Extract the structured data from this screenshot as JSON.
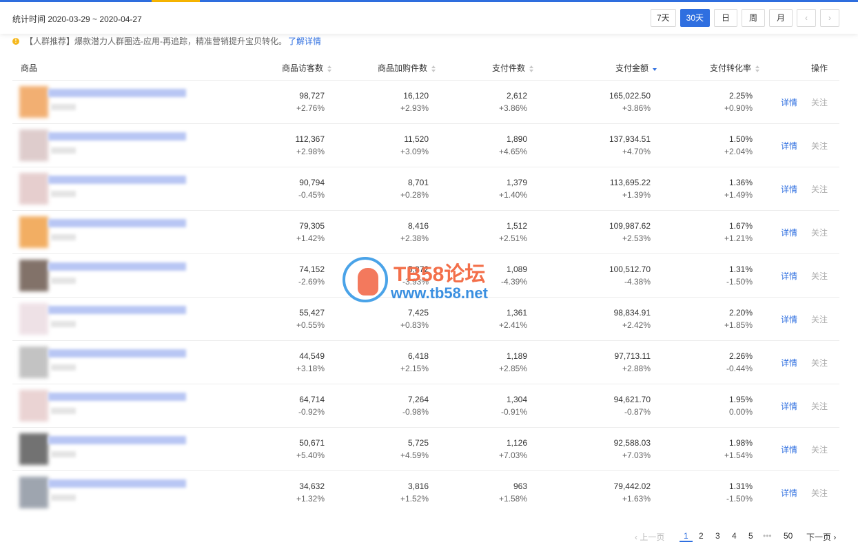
{
  "header": {
    "stat_time": "统计时间 2020-03-29 ~ 2020-04-27",
    "periods": [
      "7天",
      "30天",
      "日",
      "周",
      "月"
    ],
    "prev_arrow": "‹",
    "next_arrow": "›"
  },
  "notice": {
    "text": "【人群推荐】爆款潜力人群圈选-应用-再追踪，精准营销提升宝贝转化。",
    "link": "了解详情"
  },
  "columns": {
    "product": "商品",
    "visitors": "商品访客数",
    "cart": "商品加购件数",
    "pay_qty": "支付件数",
    "pay_amount": "支付金额",
    "conv": "支付转化率",
    "ops": "操作"
  },
  "rows": [
    {
      "visitors": "98,727",
      "visitors_chg": "+2.76%",
      "cart": "16,120",
      "cart_chg": "+2.93%",
      "pay_qty": "2,612",
      "pay_qty_chg": "+3.86%",
      "amount": "165,022.50",
      "amount_chg": "+3.86%",
      "conv": "2.25%",
      "conv_chg": "+0.90%",
      "detail": "详情",
      "follow": "关注"
    },
    {
      "visitors": "112,367",
      "visitors_chg": "+2.98%",
      "cart": "11,520",
      "cart_chg": "+3.09%",
      "pay_qty": "1,890",
      "pay_qty_chg": "+4.65%",
      "amount": "137,934.51",
      "amount_chg": "+4.70%",
      "conv": "1.50%",
      "conv_chg": "+2.04%",
      "detail": "详情",
      "follow": "关注"
    },
    {
      "visitors": "90,794",
      "visitors_chg": "-0.45%",
      "cart": "8,701",
      "cart_chg": "+0.28%",
      "pay_qty": "1,379",
      "pay_qty_chg": "+1.40%",
      "amount": "113,695.22",
      "amount_chg": "+1.39%",
      "conv": "1.36%",
      "conv_chg": "+1.49%",
      "detail": "详情",
      "follow": "关注"
    },
    {
      "visitors": "79,305",
      "visitors_chg": "+1.42%",
      "cart": "8,416",
      "cart_chg": "+2.38%",
      "pay_qty": "1,512",
      "pay_qty_chg": "+2.51%",
      "amount": "109,987.62",
      "amount_chg": "+2.53%",
      "conv": "1.67%",
      "conv_chg": "+1.21%",
      "detail": "详情",
      "follow": "关注"
    },
    {
      "visitors": "74,152",
      "visitors_chg": "-2.69%",
      "cart": "5,872",
      "cart_chg": "-3.93%",
      "pay_qty": "1,089",
      "pay_qty_chg": "-4.39%",
      "amount": "100,512.70",
      "amount_chg": "-4.38%",
      "conv": "1.31%",
      "conv_chg": "-1.50%",
      "detail": "详情",
      "follow": "关注"
    },
    {
      "visitors": "55,427",
      "visitors_chg": "+0.55%",
      "cart": "7,425",
      "cart_chg": "+0.83%",
      "pay_qty": "1,361",
      "pay_qty_chg": "+2.41%",
      "amount": "98,834.91",
      "amount_chg": "+2.42%",
      "conv": "2.20%",
      "conv_chg": "+1.85%",
      "detail": "详情",
      "follow": "关注"
    },
    {
      "visitors": "44,549",
      "visitors_chg": "+3.18%",
      "cart": "6,418",
      "cart_chg": "+2.15%",
      "pay_qty": "1,189",
      "pay_qty_chg": "+2.85%",
      "amount": "97,713.11",
      "amount_chg": "+2.88%",
      "conv": "2.26%",
      "conv_chg": "-0.44%",
      "detail": "详情",
      "follow": "关注"
    },
    {
      "visitors": "64,714",
      "visitors_chg": "-0.92%",
      "cart": "7,264",
      "cart_chg": "-0.98%",
      "pay_qty": "1,304",
      "pay_qty_chg": "-0.91%",
      "amount": "94,621.70",
      "amount_chg": "-0.87%",
      "conv": "1.95%",
      "conv_chg": "0.00%",
      "detail": "详情",
      "follow": "关注"
    },
    {
      "visitors": "50,671",
      "visitors_chg": "+5.40%",
      "cart": "5,725",
      "cart_chg": "+4.59%",
      "pay_qty": "1,126",
      "pay_qty_chg": "+7.03%",
      "amount": "92,588.03",
      "amount_chg": "+7.03%",
      "conv": "1.98%",
      "conv_chg": "+1.54%",
      "detail": "详情",
      "follow": "关注"
    },
    {
      "visitors": "34,632",
      "visitors_chg": "+1.32%",
      "cart": "3,816",
      "cart_chg": "+1.52%",
      "pay_qty": "963",
      "pay_qty_chg": "+1.58%",
      "amount": "79,442.02",
      "amount_chg": "+1.63%",
      "conv": "1.31%",
      "conv_chg": "-1.50%",
      "detail": "详情",
      "follow": "关注"
    }
  ],
  "thumb_colors": [
    "#f0a25a",
    "#d9c4c4",
    "#e2c6c6",
    "#f0a048",
    "#6d5a50",
    "#ecdce2",
    "#b9b9b9",
    "#e7cccc",
    "#5a5a5a",
    "#8e96a2"
  ],
  "pager": {
    "prev": "‹ 上一页",
    "pages": [
      "1",
      "2",
      "3",
      "4",
      "5"
    ],
    "ellipsis": "•••",
    "last": "50",
    "next": "下一页 ›"
  },
  "watermark": {
    "title": "TB58论坛",
    "url": "www.tb58.net"
  },
  "colors": {
    "accent": "#2f6fe0",
    "warn": "#f5b81d"
  }
}
